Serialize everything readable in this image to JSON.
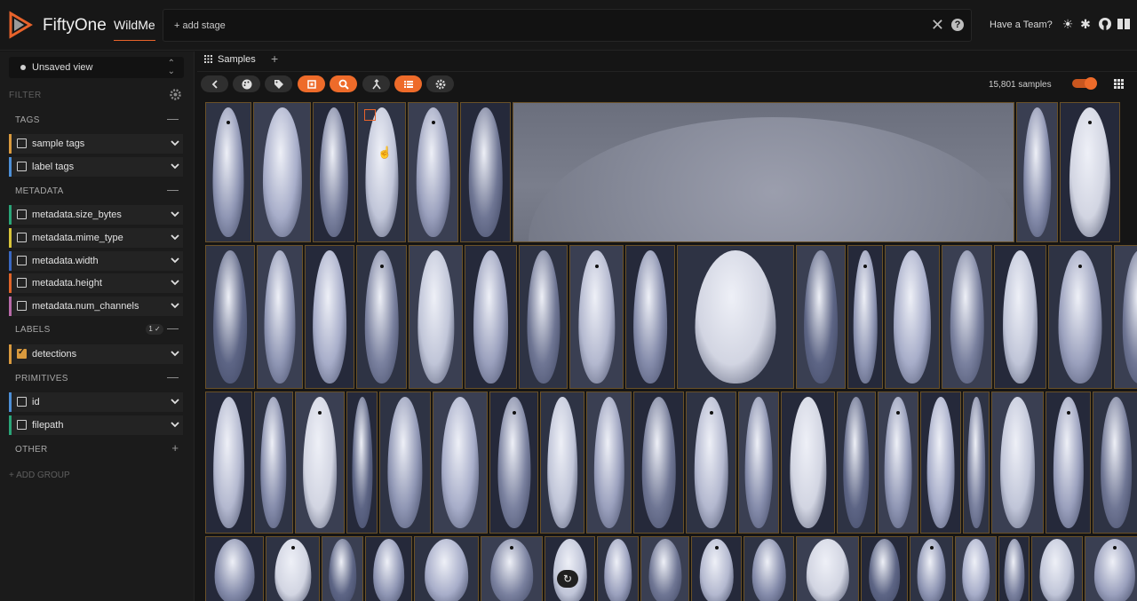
{
  "header": {
    "app_title": "FiftyOne",
    "dataset_name": "WildMe",
    "add_stage": "+ add stage",
    "help": "?",
    "have_team": "Have a Team?",
    "icons": [
      "sun-icon",
      "slack-icon",
      "github-icon",
      "docs-icon"
    ]
  },
  "sidebar": {
    "view_select": "Unsaved view",
    "filter_label": "FILTER",
    "add_group": "+ ADD GROUP",
    "groups": {
      "tags": "TAGS",
      "metadata": "METADATA",
      "labels": "LABELS",
      "labels_badge": "1 ✓",
      "primitives": "PRIMITIVES",
      "other": "OTHER"
    },
    "fields": {
      "sample_tags": "sample tags",
      "label_tags": "label tags",
      "size_bytes": "metadata.size_bytes",
      "mime_type": "metadata.mime_type",
      "width": "metadata.width",
      "height": "metadata.height",
      "num_channels": "metadata.num_channels",
      "detections": "detections",
      "id": "id",
      "filepath": "filepath"
    },
    "colors": {
      "sample_tags": "#d99a3e",
      "label_tags": "#4d8fd6",
      "size_bytes": "#2aa578",
      "mime_type": "#d8c43a",
      "width": "#3a68c2",
      "height": "#e0642a",
      "num_channels": "#b86aa8",
      "detections": "#d99a3e",
      "id": "#4d8fd6",
      "filepath": "#2aa578"
    }
  },
  "main": {
    "tab_label": "Samples",
    "tab_add": "+",
    "sample_count": "15,801 samples",
    "accent": "#ee6b2a"
  }
}
